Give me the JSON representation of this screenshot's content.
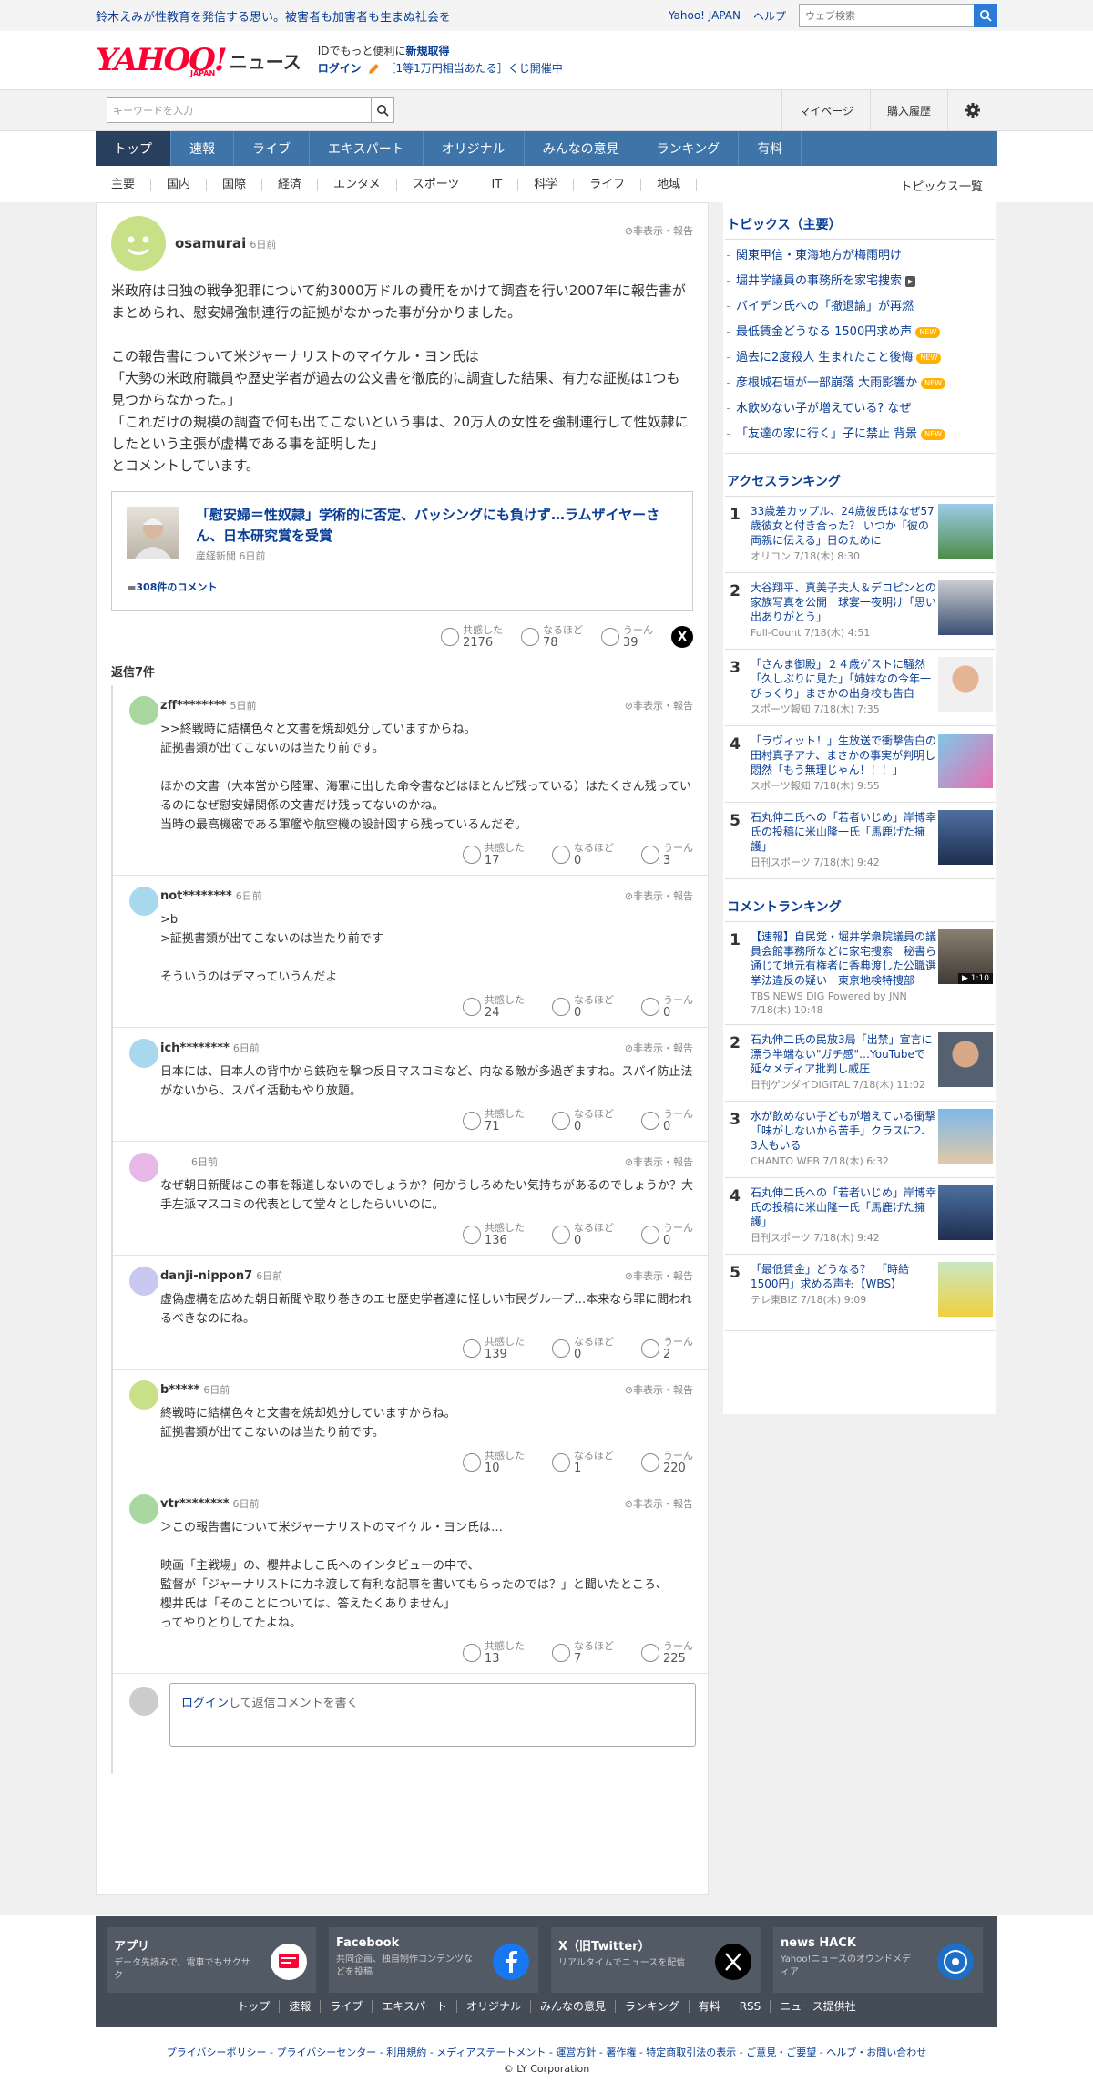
{
  "topbar": {
    "message": "鈴木えみが性教育を発信する思い。被害者も加害者も生まぬ社会を",
    "yahoo_japan": "Yahoo! JAPAN",
    "help": "ヘルプ",
    "web_search_placeholder": "ウェブ検索"
  },
  "header": {
    "logo_text": "YAHOO!",
    "logo_sub": "JAPAN",
    "logo_news": "ニュース",
    "promo_line1_prefix": "IDでもっと便利に",
    "promo_line1_link": "新規取得",
    "promo_login": "ログイン",
    "promo_line2": "［1等1万円相当あたる］くじ開催中"
  },
  "searchbar": {
    "placeholder": "キーワードを入力",
    "mypage": "マイページ",
    "purchase_history": "購入履歴"
  },
  "main_nav": [
    "トップ",
    "速報",
    "ライブ",
    "エキスパート",
    "オリジナル",
    "みんなの意見",
    "ランキング",
    "有料"
  ],
  "sub_nav": [
    "主要",
    "国内",
    "国際",
    "経済",
    "エンタメ",
    "スポーツ",
    "IT",
    "科学",
    "ライフ",
    "地域"
  ],
  "sub_nav_right": "トピックス一覧",
  "parent_comment": {
    "user": "osamurai",
    "ago": "6日前",
    "hide_report": "非表示・報告",
    "body": "米政府は日独の戦争犯罪について約3000万ドルの費用をかけて調査を行い2007年に報告書がまとめられ、慰安婦強制連行の証拠がなかった事が分かりました。\n\nこの報告書について米ジャーナリストのマイケル・ヨン氏は\n「大勢の米政府職員や歴史学者が過去の公文書を徹底的に調査した結果、有力な証拠は1つも見つからなかった。」\n「これだけの規模の調査で何も出てこないという事は、20万人の女性を強制連行して性奴隷にしたという主張が虚構である事を証明した」\nとコメントしています。",
    "link_title": "「慰安婦＝性奴隷」学術的に否定、バッシングにも負けず…ラムザイヤーさん、日本研究賞を受賞",
    "link_source": "産経新聞 6日前",
    "link_comments": "308件のコメント",
    "reactions": {
      "empathy_label": "共感した",
      "empathy": "2176",
      "insight_label": "なるほど",
      "insight": "78",
      "hmm_label": "うーん",
      "hmm": "39"
    },
    "share_x": "X"
  },
  "reply_count": "返信7件",
  "replies": [
    {
      "user": "zff********",
      "ago": "5日前",
      "avatar_color": "#a8d8a0",
      "body": ">>終戦時に結構色々と文書を焼却処分していますからね。\n証拠書類が出てこないのは当たり前です。\n\nほかの文書（大本営から陸軍、海軍に出した命令書などはほとんど残っている）はたくさん残っているのになぜ慰安婦関係の文書だけ残ってないのかね。\n当時の最高機密である軍艦や航空機の設計図すら残っているんだぞ。",
      "empathy": "17",
      "insight": "0",
      "hmm": "3"
    },
    {
      "user": "not********",
      "ago": "6日前",
      "avatar_color": "#a8d8ee",
      "body": ">b\n>証拠書類が出てこないのは当たり前です\n\nそういうのはデマっていうんだよ",
      "empathy": "24",
      "insight": "0",
      "hmm": "0"
    },
    {
      "user": "ich********",
      "ago": "6日前",
      "avatar_color": "#a8d8ee",
      "body": "日本には、日本人の背中から鉄砲を撃つ反日マスコミなど、内なる敵が多過ぎますね。スパイ防止法がないから、スパイ活動もやり放題。",
      "empathy": "71",
      "insight": "0",
      "hmm": "0"
    },
    {
      "user": "",
      "ago": "6日前",
      "avatar_color": "#e8b8e8",
      "body": "なぜ朝日新聞はこの事を報道しないのでしょうか？何かうしろめたい気持ちがあるのでしょうか？大手左派マスコミの代表として堂々としたらいいのに。",
      "empathy": "136",
      "insight": "0",
      "hmm": "0"
    },
    {
      "user": "danji-nippon7",
      "ago": "6日前",
      "avatar_color": "#c8c8f0",
      "body": "虚偽虚構を広めた朝日新聞や取り巻きのエセ歴史学者達に怪しい市民グループ…本来なら罪に問われるべきなのにね。",
      "empathy": "139",
      "insight": "0",
      "hmm": "2"
    },
    {
      "user": "b*****",
      "ago": "6日前",
      "avatar_color": "#c8e088",
      "body": "終戦時に結構色々と文書を焼却処分していますからね。\n証拠書類が出てこないのは当たり前です。",
      "empathy": "10",
      "insight": "1",
      "hmm": "220"
    },
    {
      "user": "vtr********",
      "ago": "6日前",
      "avatar_color": "#a8d8a0",
      "body": "＞この報告書について米ジャーナリストのマイケル・ヨン氏は…\n\n映画「主戦場」の、櫻井よしこ氏へのインタビューの中で、\n監督が「ジャーナリストにカネ渡して有利な記事を書いてもらったのでは？」と聞いたところ、\n櫻井氏は「そのことについては、答えたくありません」\nってやりとりしてたよね。",
      "empathy": "13",
      "insight": "7",
      "hmm": "225"
    }
  ],
  "reply_box": {
    "login": "ログイン",
    "placeholder_rest": "して返信コメントを書く"
  },
  "topics": {
    "heading": "トピックス（主要）",
    "items": [
      {
        "title": "関東甲信・東海地方が梅雨明け",
        "badge": ""
      },
      {
        "title": "堀井学議員の事務所を家宅捜索",
        "badge": "video"
      },
      {
        "title": "バイデン氏への「撤退論」が再燃",
        "badge": ""
      },
      {
        "title": "最低賃金どうなる 1500円求め声",
        "badge": "NEW"
      },
      {
        "title": "過去に2度殺人 生まれたこと後悔",
        "badge": "NEW"
      },
      {
        "title": "彦根城石垣が一部崩落 大雨影響か",
        "badge": "NEW"
      },
      {
        "title": "水飲めない子が増えている? なぜ",
        "badge": ""
      },
      {
        "title": "「友達の家に行く」子に禁止 背景",
        "badge": "NEW"
      }
    ],
    "new_label": "NEW",
    "video_label": "▶"
  },
  "access_ranking": {
    "heading": "アクセスランキング",
    "items": [
      {
        "no": "1",
        "title": "33歳差カップル、24歳彼氏はなぜ57歳彼女と付き合った？ いつか「彼の両親に伝える」日のために",
        "source": "オリコン 7/18(木) 8:30"
      },
      {
        "no": "2",
        "title": "大谷翔平、真美子夫人＆デコピンとの家族写真を公開　球宴一夜明け「思い出ありがとう」",
        "source": "Full-Count 7/18(木) 4:51"
      },
      {
        "no": "3",
        "title": "「さんま御殿」２４歳ゲストに騒然「久しぶりに見た」「姉妹なの今年一びっくり」まさかの出身校も告白",
        "source": "スポーツ報知 7/18(木) 7:35"
      },
      {
        "no": "4",
        "title": "「ラヴィット！」生放送で衝撃告白の田村真子アナ、まさかの事実が判明し悶然「もう無理じゃん！！！」",
        "source": "スポーツ報知 7/18(木) 9:55"
      },
      {
        "no": "5",
        "title": "石丸伸二氏への「若者いじめ」岸博幸氏の投稿に米山隆一氏「馬鹿げた擁護」",
        "source": "日刊スポーツ 7/18(木) 9:42"
      }
    ]
  },
  "comment_ranking": {
    "heading": "コメントランキング",
    "items": [
      {
        "no": "1",
        "title": "【速報】自民党・堀井学衆院議員の議員会館事務所などに家宅捜索　秘書ら通じて地元有権者に香典渡した公職選挙法違反の疑い　東京地検特捜部",
        "source": "TBS NEWS DIG Powered by JNN 7/18(木) 10:48",
        "video": "▶ 1:10"
      },
      {
        "no": "2",
        "title": "石丸伸二氏の民放3局「出禁」宣言に漂う半端ない\"ガチ感\"…YouTubeで延々メディア批判し威圧",
        "source": "日刊ゲンダイDIGITAL 7/18(木) 11:02",
        "video": ""
      },
      {
        "no": "3",
        "title": "水が飲めない子どもが増えている衝撃「味がしないから苦手」クラスに2、3人もいる",
        "source": "CHANTO WEB 7/18(木) 6:32",
        "video": ""
      },
      {
        "no": "4",
        "title": "石丸伸二氏への「若者いじめ」岸博幸氏の投稿に米山隆一氏「馬鹿げた擁護」",
        "source": "日刊スポーツ 7/18(木) 9:42",
        "video": ""
      },
      {
        "no": "5",
        "title": "「最低賃金」どうなる？　「時給1500円」求める声も【WBS】",
        "source": "テレ東BIZ 7/18(木) 9:09",
        "video": ""
      }
    ]
  },
  "footer": {
    "apps": [
      {
        "name": "アプリ",
        "desc": "データ先読みで、電車でもサクサク"
      },
      {
        "name": "Facebook",
        "desc": "共同企画、独自制作コンテンツなどを投稿"
      },
      {
        "name": "X（旧Twitter）",
        "desc": "リアルタイムでニュースを配信"
      },
      {
        "name": "news HACK",
        "desc": "Yahoo!ニュースのオウンドメディア"
      }
    ],
    "links": [
      "トップ",
      "速報",
      "ライブ",
      "エキスパート",
      "オリジナル",
      "みんなの意見",
      "ランキング",
      "有料",
      "RSS",
      "ニュース提供社"
    ],
    "legal": "プライバシーポリシー - プライバシーセンター - 利用規約 - メディアステートメント - 運営方針 - 著作権 - 特定商取引法の表示 - ご意見・ご要望 - ヘルプ・お問い合わせ",
    "copyright": "© LY Corporation"
  },
  "colors": {
    "accent": "#0a3e96",
    "nav_bg": "#3f74a8",
    "nav_active": "#28405e",
    "brand_red": "#ff0033"
  }
}
